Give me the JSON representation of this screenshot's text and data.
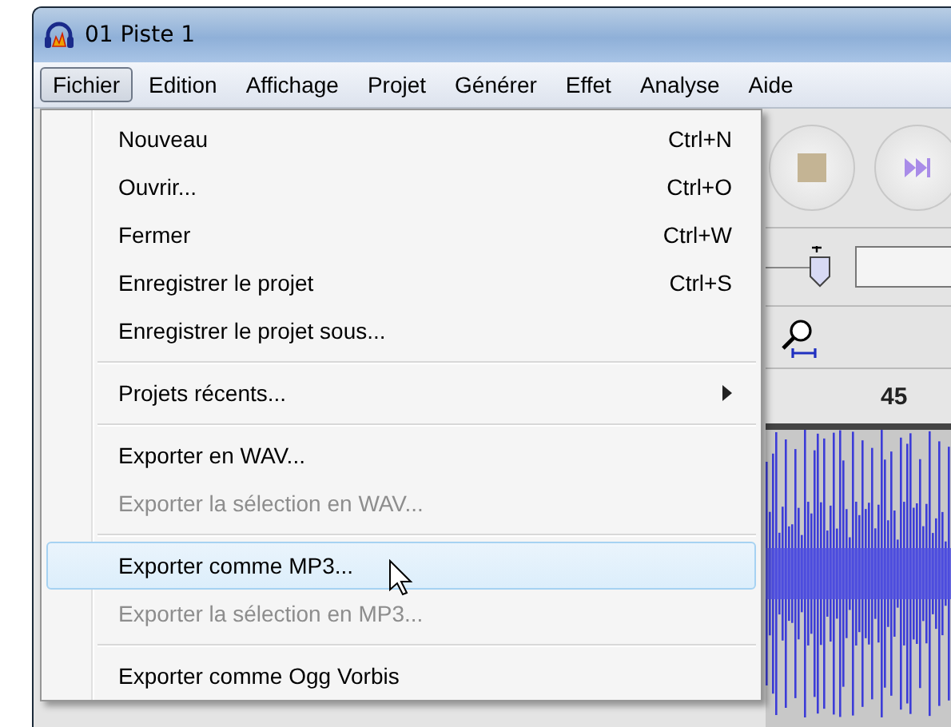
{
  "window": {
    "title": "01 Piste 1"
  },
  "menubar": [
    {
      "label": "Fichier",
      "selected": true
    },
    {
      "label": "Edition",
      "selected": false
    },
    {
      "label": "Affichage",
      "selected": false
    },
    {
      "label": "Projet",
      "selected": false
    },
    {
      "label": "Générer",
      "selected": false
    },
    {
      "label": "Effet",
      "selected": false
    },
    {
      "label": "Analyse",
      "selected": false
    },
    {
      "label": "Aide",
      "selected": false
    }
  ],
  "menu": {
    "items": [
      {
        "kind": "item",
        "label": "Nouveau",
        "shortcut": "Ctrl+N",
        "disabled": false,
        "selected": false
      },
      {
        "kind": "item",
        "label": "Ouvrir...",
        "shortcut": "Ctrl+O",
        "disabled": false,
        "selected": false
      },
      {
        "kind": "item",
        "label": "Fermer",
        "shortcut": "Ctrl+W",
        "disabled": false,
        "selected": false
      },
      {
        "kind": "item",
        "label": "Enregistrer le projet",
        "shortcut": "Ctrl+S",
        "disabled": false,
        "selected": false
      },
      {
        "kind": "item",
        "label": "Enregistrer le projet sous...",
        "disabled": false,
        "selected": false
      },
      {
        "kind": "separator"
      },
      {
        "kind": "submenu",
        "label": "Projets récents...",
        "disabled": false,
        "selected": false
      },
      {
        "kind": "separator"
      },
      {
        "kind": "item",
        "label": "Exporter en WAV...",
        "disabled": false,
        "selected": false
      },
      {
        "kind": "item",
        "label": "Exporter la sélection en WAV...",
        "disabled": true,
        "selected": false
      },
      {
        "kind": "separator"
      },
      {
        "kind": "item",
        "label": "Exporter comme MP3...",
        "disabled": false,
        "selected": true
      },
      {
        "kind": "item",
        "label": "Exporter la sélection en MP3...",
        "disabled": true,
        "selected": false
      },
      {
        "kind": "separator"
      },
      {
        "kind": "item",
        "label": "Exporter comme Ogg Vorbis",
        "disabled": false,
        "selected": false
      }
    ]
  },
  "ruler": {
    "label": "45"
  }
}
